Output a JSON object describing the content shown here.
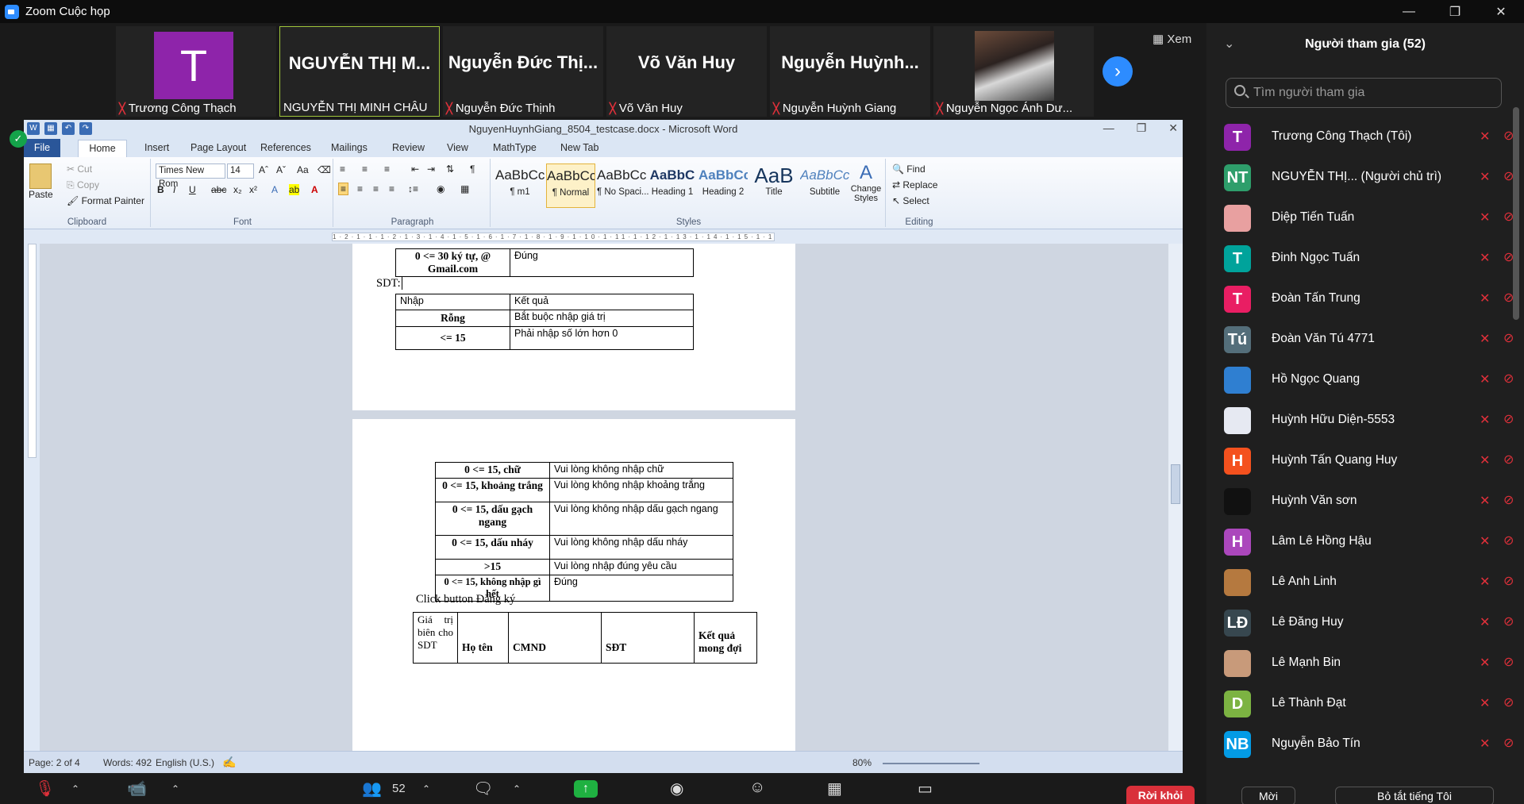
{
  "zoom": {
    "window_title": "Zoom Cuộc họp",
    "view_label": "Xem",
    "leave_label": "Rời khỏi",
    "participant_count": "52",
    "tiles": [
      {
        "big": "",
        "label": "Trương Công Thạch",
        "avatar_letter": "T"
      },
      {
        "big": "NGUYỄN THỊ M...",
        "label": "NGUYỄN THỊ MINH CHÂU"
      },
      {
        "big": "Nguyễn Đức Thị...",
        "label": "Nguyễn Đức Thịnh"
      },
      {
        "big": "Võ Văn Huy",
        "label": "Võ Văn Huy"
      },
      {
        "big": "Nguyễn Huỳnh...",
        "label": "Nguyễn Huỳnh Giang"
      },
      {
        "big": "",
        "label": "Nguyễn Ngọc Ánh Dư..."
      }
    ]
  },
  "word": {
    "doc_title": "NguyenHuynhGiang_8504_testcase.docx - Microsoft Word",
    "tabs": [
      "File",
      "Home",
      "Insert",
      "Page Layout",
      "References",
      "Mailings",
      "Review",
      "View",
      "MathType",
      "New Tab"
    ],
    "clipboard": {
      "paste": "Paste",
      "cut": "Cut",
      "copy": "Copy",
      "format_painter": "Format Painter",
      "group": "Clipboard"
    },
    "font": {
      "name": "Times New Rom",
      "size": "14",
      "group": "Font"
    },
    "paragraph_group": "Paragraph",
    "styles": [
      {
        "sample": "AaBbCcI",
        "name": "¶ m1"
      },
      {
        "sample": "AaBbCc",
        "name": "¶ Normal"
      },
      {
        "sample": "AaBbCc",
        "name": "¶ No Spaci..."
      },
      {
        "sample": "AaBbC",
        "name": "Heading 1"
      },
      {
        "sample": "AaBbCc",
        "name": "Heading 2"
      },
      {
        "sample": "AaB",
        "name": "Title"
      },
      {
        "sample": "AaBbCc.",
        "name": "Subtitle"
      }
    ],
    "styles_group": "Styles",
    "change_styles": "Change Styles",
    "editing": {
      "find": "Find",
      "replace": "Replace",
      "select": "Select",
      "group": "Editing"
    },
    "doc": {
      "top_table": [
        {
          "left": "0 <=  30 ký tự, @ Gmail.com",
          "right": "Đúng"
        }
      ],
      "sdt_label": "SDT:",
      "sdt_table": [
        {
          "left": "Nhập",
          "right": "Kết quả"
        },
        {
          "left": "Rỗng",
          "right": "Bắt buộc nhập giá trị"
        },
        {
          "left": "<= 15",
          "right": "Phải nhập số lớn hơn 0"
        }
      ],
      "page2_table": [
        {
          "left": "0 <=  15, chữ",
          "right": "Vui lòng không nhập chữ"
        },
        {
          "left": "0 <=  15, khoảng trắng",
          "right": "Vui lòng không nhập khoảng trắng"
        },
        {
          "left": "0 <=  15, dấu gạch ngang",
          "right": "Vui lòng không nhập dấu gạch ngang"
        },
        {
          "left": "0 <=  15, dấu nháy",
          "right": "Vui lòng không nhập dấu nháy"
        },
        {
          "left": ">15",
          "right": "Vui lòng nhập đúng yêu cầu"
        },
        {
          "left": "0 <= 15, không nhập gì hết",
          "right": "Đúng"
        }
      ],
      "click_text": "Click button Đăng ký",
      "header_cols": [
        "Giá trị biên cho SDT",
        "Họ tên",
        "CMND",
        "SĐT",
        "Kết quả mong đợi"
      ]
    },
    "status": {
      "page": "Page: 2 of 4",
      "words": "Words: 492",
      "lang": "English (U.S.)",
      "zoom": "80%"
    }
  },
  "panel": {
    "title": "Người tham gia (52)",
    "search_placeholder": "Tìm người tham gia",
    "participants": [
      {
        "initials": "T",
        "name": "Trương Công Thạch (Tôi)",
        "color": "#8e24aa"
      },
      {
        "initials": "NT",
        "name": "NGUYỄN THỊ... (Người chủ trì)",
        "color": "#2e9e6b"
      },
      {
        "initials": "",
        "name": "Diệp Tiến Tuấn",
        "color": "#e8a0a0"
      },
      {
        "initials": "T",
        "name": "Đinh Ngọc Tuấn",
        "color": "#00a39b"
      },
      {
        "initials": "T",
        "name": "Đoàn Tấn Trung",
        "color": "#e91e63"
      },
      {
        "initials": "Tú",
        "name": "Đoàn Văn Tú 4771",
        "color": "#546e7a"
      },
      {
        "initials": "",
        "name": "Hồ Ngọc Quang",
        "color": "#2f7fd1"
      },
      {
        "initials": "",
        "name": "Huỳnh Hữu Diện-5553",
        "color": "#e6e9f2"
      },
      {
        "initials": "H",
        "name": "Huỳnh Tấn Quang Huy",
        "color": "#f4511e"
      },
      {
        "initials": "",
        "name": "Huỳnh Văn sơn",
        "color": "#111111"
      },
      {
        "initials": "H",
        "name": "Lâm Lê Hồng Hậu",
        "color": "#ab47bc"
      },
      {
        "initials": "",
        "name": "Lê Anh Linh",
        "color": "#b5793f"
      },
      {
        "initials": "LĐ",
        "name": "Lê Đăng Huy",
        "color": "#37474f"
      },
      {
        "initials": "",
        "name": "Lê Mạnh Bin",
        "color": "#c89a7a"
      },
      {
        "initials": "D",
        "name": "Lê Thành Đạt",
        "color": "#7cb342"
      },
      {
        "initials": "NB",
        "name": "Nguyễn Bảo Tín",
        "color": "#039be5"
      }
    ],
    "invite_label": "Mời",
    "mute_all_label": "Bỏ tắt tiếng Tôi"
  }
}
